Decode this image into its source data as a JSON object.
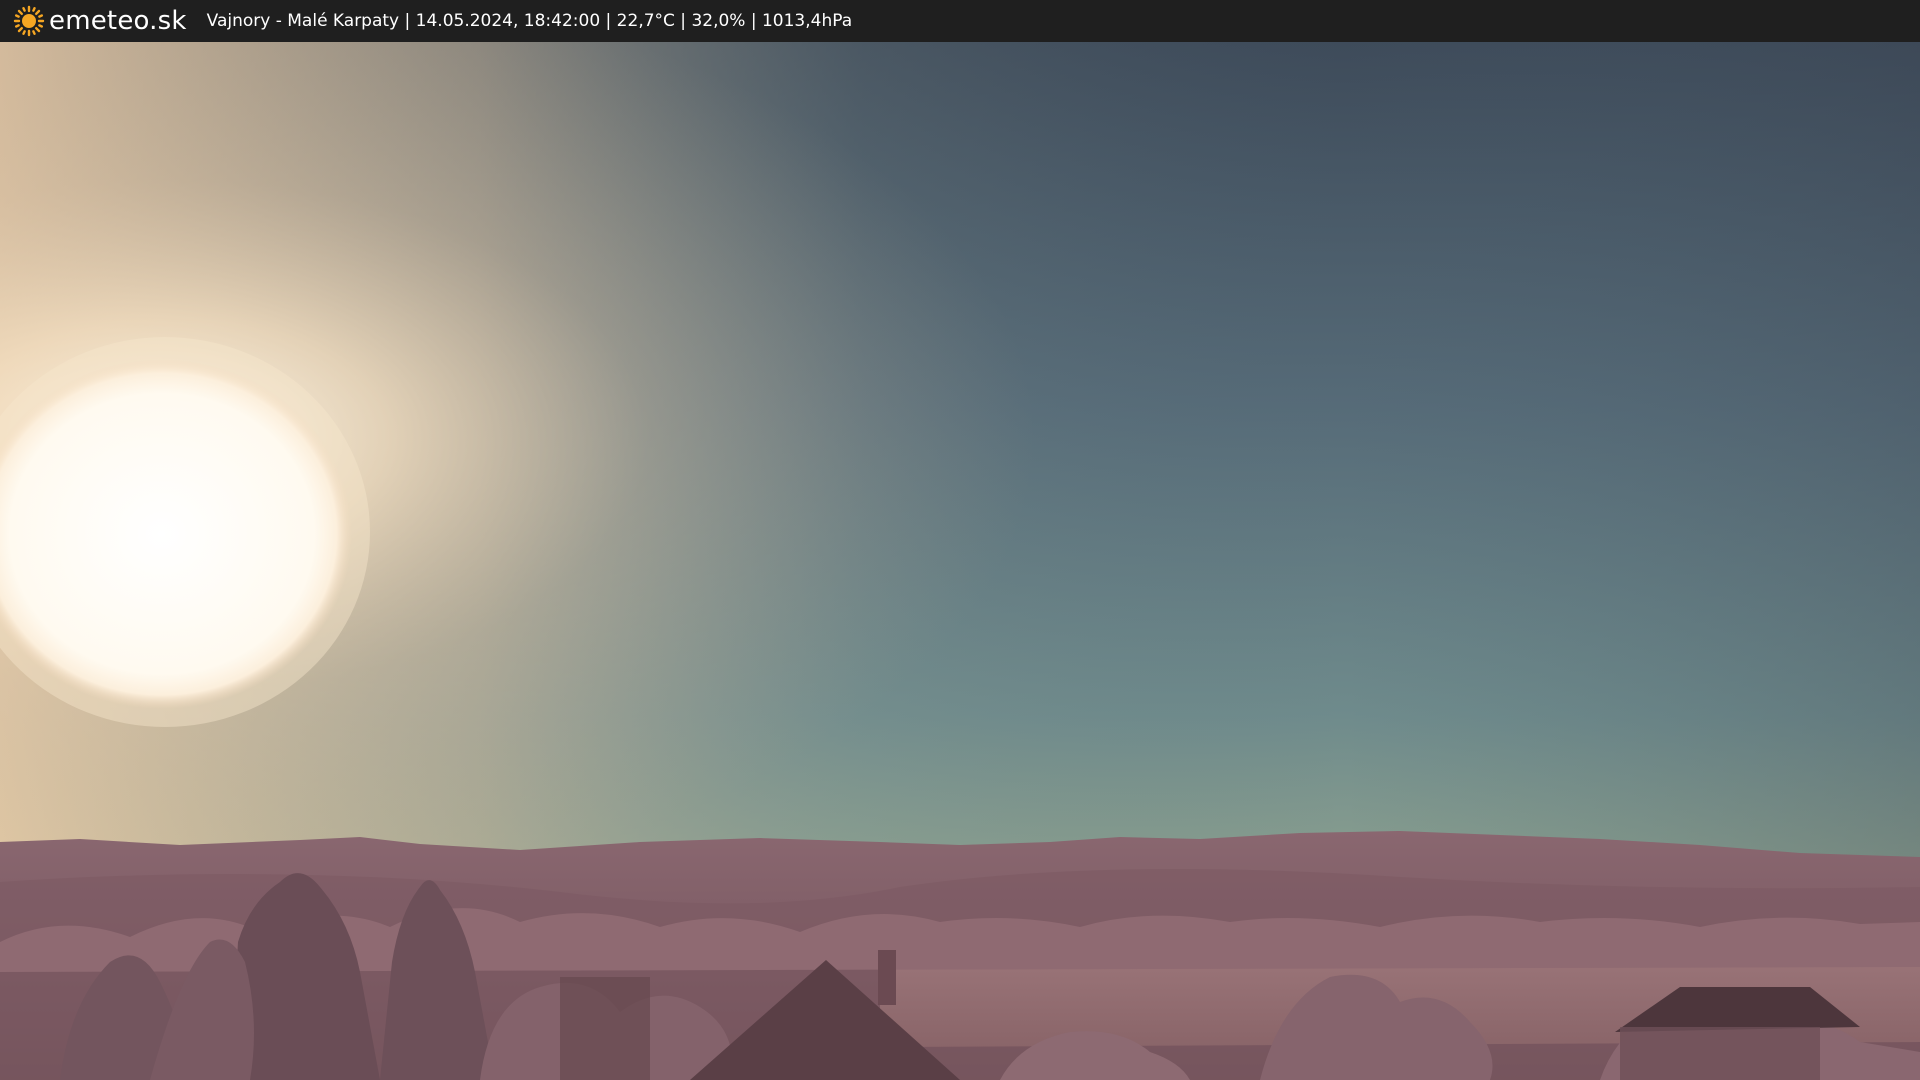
{
  "header": {
    "logo_text": "emeteo.sk",
    "logo_icon": "sun-icon",
    "caption": "Vajnory - Malé Karpaty | 14.05.2024, 18:42:00 | 22,7°C | 32,0% | 1013,4hPa"
  },
  "scene": {
    "description_tags": [
      "sun",
      "sky",
      "hills",
      "trees",
      "rooftops",
      "field"
    ]
  },
  "colors": {
    "bar_background": "#1f1f1f",
    "logo_sun": "#f5a623",
    "text": "#ffffff"
  }
}
